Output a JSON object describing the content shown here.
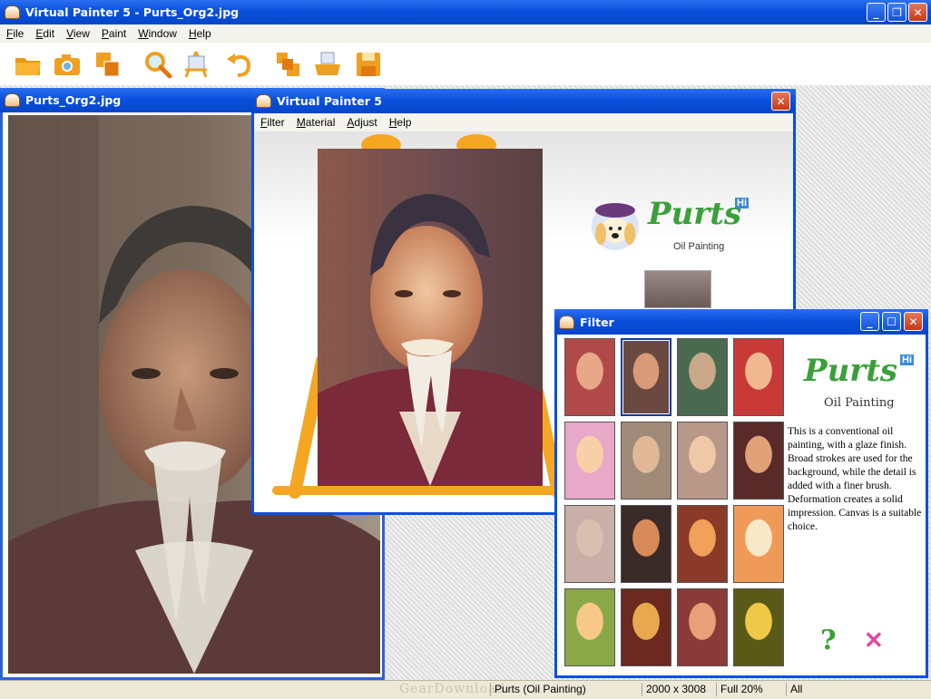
{
  "app": {
    "title": "Virtual Painter 5 - Purts_Org2.jpg",
    "menu": [
      "File",
      "Edit",
      "View",
      "Paint",
      "Window",
      "Help"
    ]
  },
  "toolbar": [
    "open-folder",
    "camera",
    "layers",
    "zoom",
    "easel",
    "undo",
    "copy-layer",
    "print",
    "save"
  ],
  "image_window": {
    "title": "Purts_Org2.jpg"
  },
  "vp_window": {
    "title": "Virtual Painter 5",
    "menu": [
      "Filter",
      "Material",
      "Adjust",
      "Help"
    ],
    "logo_text": "Purts",
    "logo_badge": "Hi",
    "style_label": "Oil Painting"
  },
  "filter_window": {
    "title": "Filter",
    "logo_text": "Purts",
    "logo_badge": "Hi",
    "style_label": "Oil Painting",
    "description": "This is a conventional oil painting, with a glaze finish. Broad strokes are used for the background, while the detail is added with a finer brush. Deformation creates a solid impression. Canvas is a suitable choice.",
    "thumbnails": 16,
    "selected_index": 1,
    "help_button": "?",
    "close_button": "✕"
  },
  "status": {
    "filter": "Purts  (Oil Painting)",
    "size": "2000 x 3008",
    "zoom": "Full  20%",
    "scope": "All"
  },
  "watermark": "GearDownload",
  "colors": {
    "title_blue": "#0a50dc",
    "accent_orange": "#f5a623",
    "logo_green": "#3aa03a"
  }
}
